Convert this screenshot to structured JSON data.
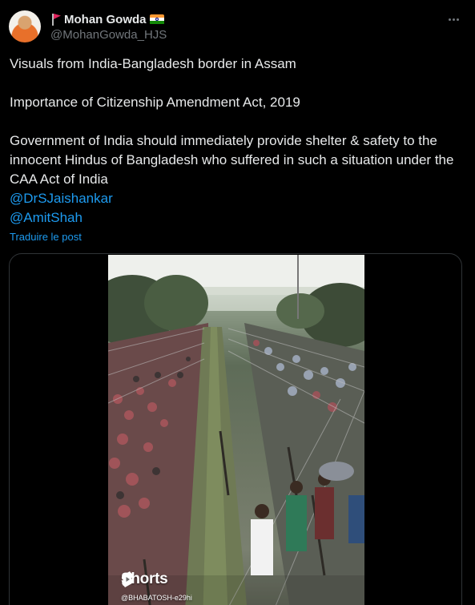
{
  "author": {
    "display_name": "Mohan Gowda",
    "handle": "@MohanGowda_HJS",
    "avatar": "avatar-image",
    "name_prefix_icon": "red-flag-icon",
    "name_suffix_icon": "india-flag-icon"
  },
  "post": {
    "line1": "Visuals from India-Bangladesh border in Assam",
    "line2": "Importance of Citizenship Amendment Act, 2019",
    "line3": "Government of India should immediately provide shelter & safety to the innocent Hindus of Bangladesh who suffered in such a situation under the CAA Act of India",
    "mentions": [
      "@DrSJaishankar",
      "@AmitShah"
    ],
    "translate_label": "Traduire le post"
  },
  "media": {
    "type": "video",
    "watermark_brand": "Shorts",
    "watermark_handle": "@BHABATOSH-e29hi"
  },
  "actions": {
    "more_icon": "more-horizontal-icon"
  },
  "colors": {
    "background": "#000000",
    "text": "#e7e9ea",
    "secondary": "#71767b",
    "link": "#1d9bf0",
    "border": "#2f3336",
    "shorts_red": "#ff0000"
  }
}
